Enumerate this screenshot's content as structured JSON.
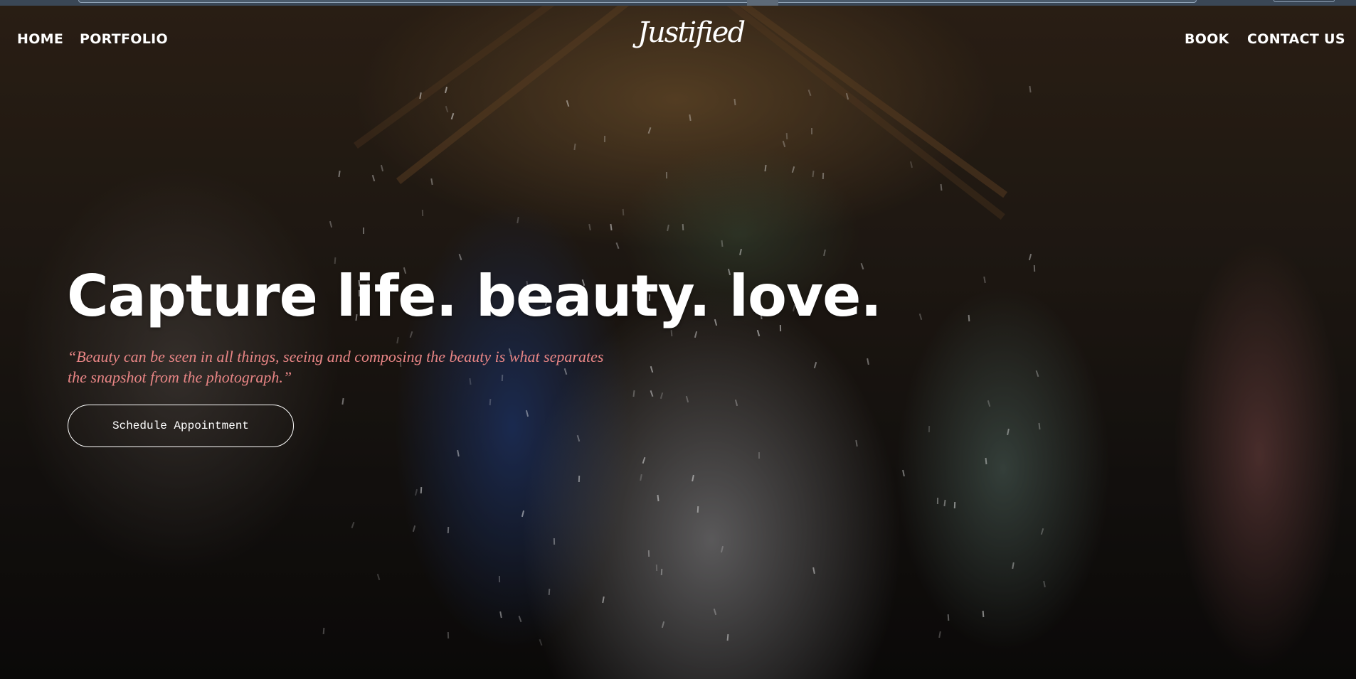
{
  "nav": {
    "home": "HOME",
    "portfolio": "PORTFOLIO",
    "book": "BOOK",
    "contact": "CONTACT US"
  },
  "logo": {
    "text": "Justified"
  },
  "hero": {
    "headline": "Capture life. beauty. love.",
    "quote_line1": "“Beauty can be seen in all things, seeing and composing the beauty is what separates",
    "quote_line2": "the snapshot from the photograph.”",
    "cta_label": "Schedule Appointment"
  },
  "colors": {
    "quote": "#e88585",
    "text": "#ffffff",
    "browser_bar": "#3a4756"
  }
}
